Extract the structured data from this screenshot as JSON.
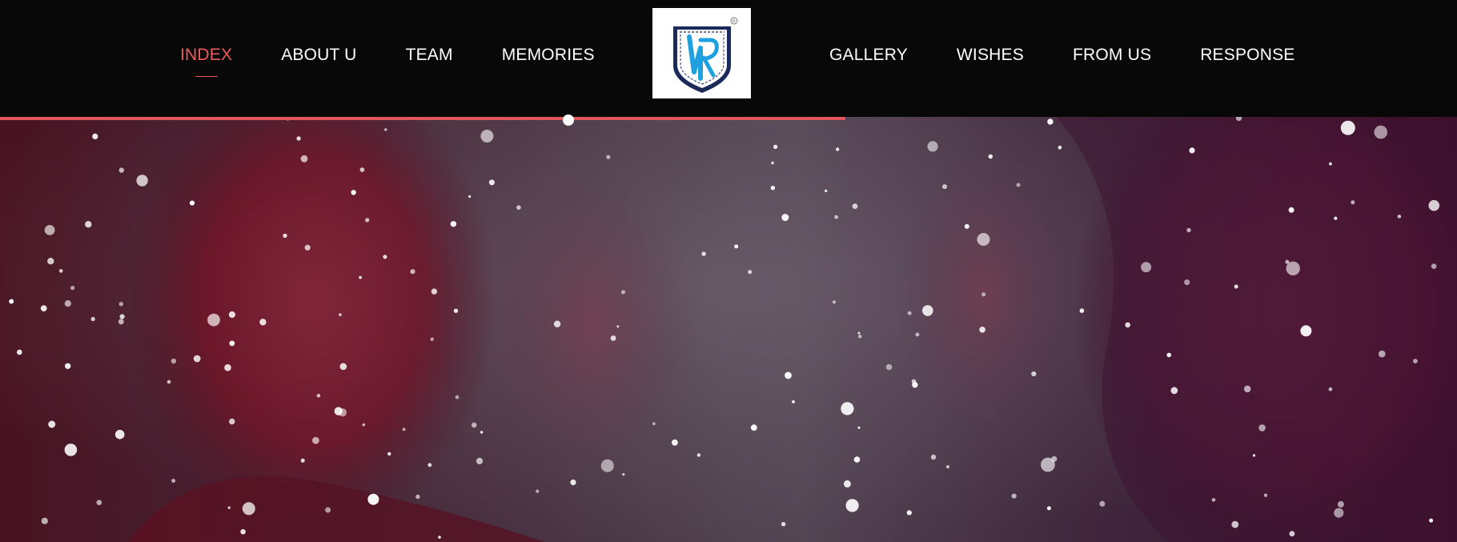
{
  "nav": {
    "left": [
      "INDEX",
      "ABOUT U",
      "TEAM",
      "MEMORIES"
    ],
    "right": [
      "GALLERY",
      "WISHES",
      "FROM US",
      "RESPONSE"
    ],
    "active_index": 0
  },
  "logo": {
    "icon": "shield-crest-logo-icon",
    "colors": {
      "frame": "#1a2a5a",
      "accent": "#1fa0e0"
    }
  },
  "scroll_progress": 0.67,
  "colors": {
    "header_bg": "#080808",
    "nav_text": "#ffffff",
    "active": "#ec5b5b",
    "progress": "#e0575b"
  },
  "hero": {
    "background": "blurred photo of people at a party with falling snow-like particles",
    "overlay_color": "#6a1030"
  }
}
